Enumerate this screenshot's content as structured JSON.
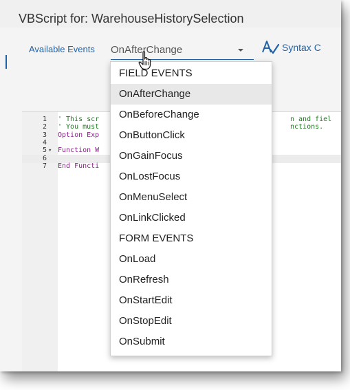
{
  "dialog": {
    "title": "VBScript for: WarehouseHistorySelection"
  },
  "events": {
    "label": "Available Events",
    "selected_value": "OnAfterChange",
    "syntax_check_label": "Syntax C"
  },
  "editor": {
    "lines": [
      {
        "number": "1",
        "fold": "",
        "text": "' This scr",
        "tail": "n and fiel",
        "kind": "comment"
      },
      {
        "number": "2",
        "fold": "",
        "text": "' You must",
        "tail": "nctions.",
        "kind": "comment"
      },
      {
        "number": "3",
        "fold": "",
        "text": "Option Exp",
        "tail": "",
        "kind": "keyword"
      },
      {
        "number": "4",
        "fold": "",
        "text": "",
        "tail": "",
        "kind": "plain"
      },
      {
        "number": "5",
        "fold": "▾",
        "text": "Function W",
        "tail": "",
        "kind": "keyword"
      },
      {
        "number": "6",
        "fold": "",
        "text": "",
        "tail": "",
        "kind": "active"
      },
      {
        "number": "7",
        "fold": "",
        "text": "End Functi",
        "tail": "",
        "kind": "keyword"
      }
    ]
  },
  "dropdown": {
    "items": [
      {
        "label": "FIELD EVENTS",
        "type": "header"
      },
      {
        "label": "OnAfterChange",
        "type": "option",
        "selected": true
      },
      {
        "label": "OnBeforeChange",
        "type": "option"
      },
      {
        "label": "OnButtonClick",
        "type": "option"
      },
      {
        "label": "OnGainFocus",
        "type": "option"
      },
      {
        "label": "OnLostFocus",
        "type": "option"
      },
      {
        "label": "OnMenuSelect",
        "type": "option"
      },
      {
        "label": "OnLinkClicked",
        "type": "option"
      },
      {
        "label": "FORM EVENTS",
        "type": "header"
      },
      {
        "label": "OnLoad",
        "type": "option"
      },
      {
        "label": "OnRefresh",
        "type": "option"
      },
      {
        "label": "OnStartEdit",
        "type": "option"
      },
      {
        "label": "OnStopEdit",
        "type": "option"
      },
      {
        "label": "OnSubmit",
        "type": "option"
      }
    ]
  },
  "icons": {
    "chevron": "chevron-down-icon",
    "cursor": "hand-cursor-icon",
    "syntax": "syntax-check-icon",
    "fold": "fold-arrow-icon"
  },
  "colors": {
    "accent": "#2162a6",
    "comment": "#1f7a1f",
    "keyword": "#8a1f8a",
    "selected_bg": "#e8e8e8"
  }
}
